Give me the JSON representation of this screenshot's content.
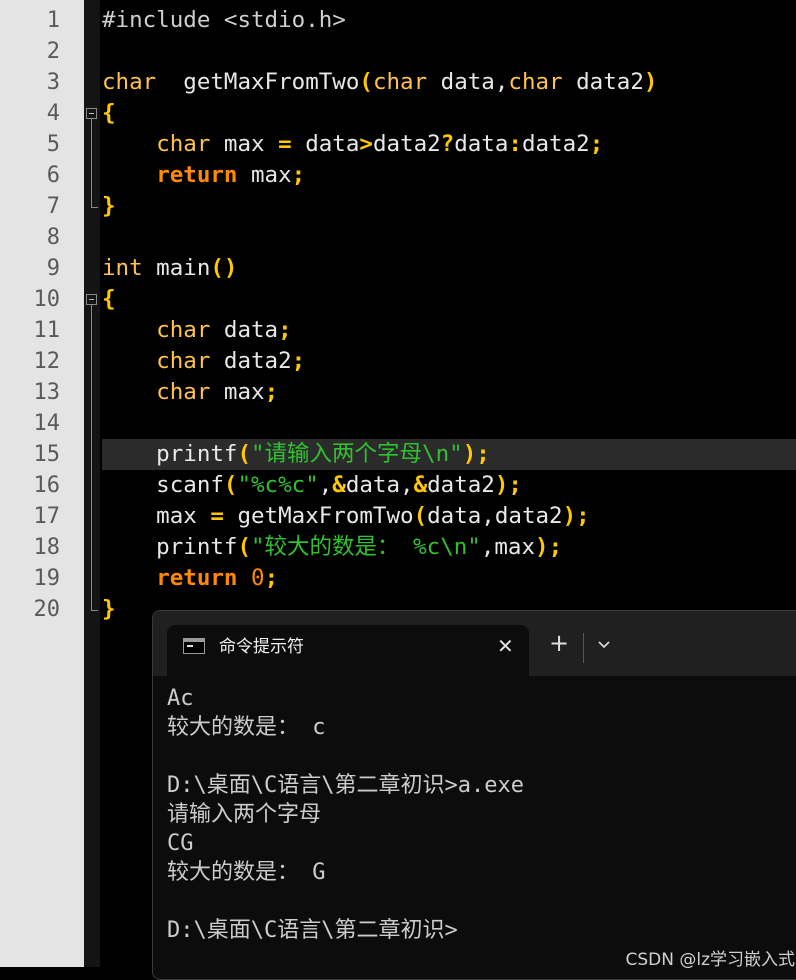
{
  "editor": {
    "line_numbers": [
      "1",
      "2",
      "3",
      "4",
      "5",
      "6",
      "7",
      "8",
      "9",
      "10",
      "11",
      "12",
      "13",
      "14",
      "15",
      "16",
      "17",
      "18",
      "19",
      "20"
    ],
    "current_line": 15,
    "lines": [
      [
        [
          "pp",
          "#include <stdio.h>"
        ]
      ],
      [],
      [
        [
          "kw",
          "char"
        ],
        [
          "",
          "  getMaxFromTwo"
        ],
        [
          "op",
          "("
        ],
        [
          "kw",
          "char"
        ],
        [
          "",
          " data,"
        ],
        [
          "kw",
          "char"
        ],
        [
          "",
          " data2"
        ],
        [
          "op",
          ")"
        ]
      ],
      [
        [
          "op",
          "{"
        ]
      ],
      [
        [
          "",
          "    "
        ],
        [
          "kw",
          "char"
        ],
        [
          "",
          " max "
        ],
        [
          "op",
          "="
        ],
        [
          "",
          " data"
        ],
        [
          "op",
          ">"
        ],
        [
          "",
          "data2"
        ],
        [
          "op",
          "?"
        ],
        [
          "",
          "data"
        ],
        [
          "op",
          ":"
        ],
        [
          "",
          "data2"
        ],
        [
          "op",
          ";"
        ]
      ],
      [
        [
          "",
          "    "
        ],
        [
          "kwb",
          "return"
        ],
        [
          "",
          " max"
        ],
        [
          "op",
          ";"
        ]
      ],
      [
        [
          "op",
          "}"
        ]
      ],
      [],
      [
        [
          "kw",
          "int"
        ],
        [
          "",
          " main"
        ],
        [
          "op",
          "()"
        ]
      ],
      [
        [
          "op",
          "{"
        ]
      ],
      [
        [
          "",
          "    "
        ],
        [
          "kw",
          "char"
        ],
        [
          "",
          " data"
        ],
        [
          "op",
          ";"
        ]
      ],
      [
        [
          "",
          "    "
        ],
        [
          "kw",
          "char"
        ],
        [
          "",
          " data2"
        ],
        [
          "op",
          ";"
        ]
      ],
      [
        [
          "",
          "    "
        ],
        [
          "kw",
          "char"
        ],
        [
          "",
          " max"
        ],
        [
          "op",
          ";"
        ]
      ],
      [],
      [
        [
          "",
          "    printf"
        ],
        [
          "op",
          "("
        ],
        [
          "str",
          "\"请输入两个字母\\n\""
        ],
        [
          "op",
          ");"
        ]
      ],
      [
        [
          "",
          "    scanf"
        ],
        [
          "op",
          "("
        ],
        [
          "str",
          "\"%c%c\""
        ],
        [
          "",
          ","
        ],
        [
          "op",
          "&"
        ],
        [
          "",
          "data,"
        ],
        [
          "op",
          "&"
        ],
        [
          "",
          "data2"
        ],
        [
          "op",
          ");"
        ]
      ],
      [
        [
          "",
          "    max "
        ],
        [
          "op",
          "="
        ],
        [
          "",
          " getMaxFromTwo"
        ],
        [
          "op",
          "("
        ],
        [
          "",
          "data,data2"
        ],
        [
          "op",
          ");"
        ]
      ],
      [
        [
          "",
          "    printf"
        ],
        [
          "op",
          "("
        ],
        [
          "str",
          "\"较大的数是： %c\\n\""
        ],
        [
          "",
          ",max"
        ],
        [
          "op",
          ");"
        ]
      ],
      [
        [
          "",
          "    "
        ],
        [
          "kwb",
          "return"
        ],
        [
          "",
          " "
        ],
        [
          "num",
          "0"
        ],
        [
          "op",
          ";"
        ]
      ],
      [
        [
          "op",
          "}"
        ]
      ]
    ]
  },
  "terminal": {
    "tab_title": "命令提示符",
    "close_glyph": "✕",
    "new_tab_glyph": "+",
    "lines": [
      "Ac",
      "较大的数是： c",
      "",
      "D:\\桌面\\C语言\\第二章初识>a.exe",
      "请输入两个字母",
      "CG",
      "较大的数是： G",
      "",
      "D:\\桌面\\C语言\\第二章初识>"
    ]
  },
  "watermark": "CSDN @lz学习嵌入式",
  "icons": {
    "terminal_tab": "terminal-icon",
    "close": "close-icon",
    "new_tab": "plus-icon",
    "dropdown": "chevron-down-icon"
  },
  "colors": {
    "keyword": "#ffc24a",
    "return_keyword": "#ff8a00",
    "operator": "#ffc800",
    "string": "#30c030",
    "number": "#ff8a00",
    "gutter": "#e4e4e4",
    "editor_bg": "#000000",
    "terminal_bg": "#0c0c0c"
  }
}
